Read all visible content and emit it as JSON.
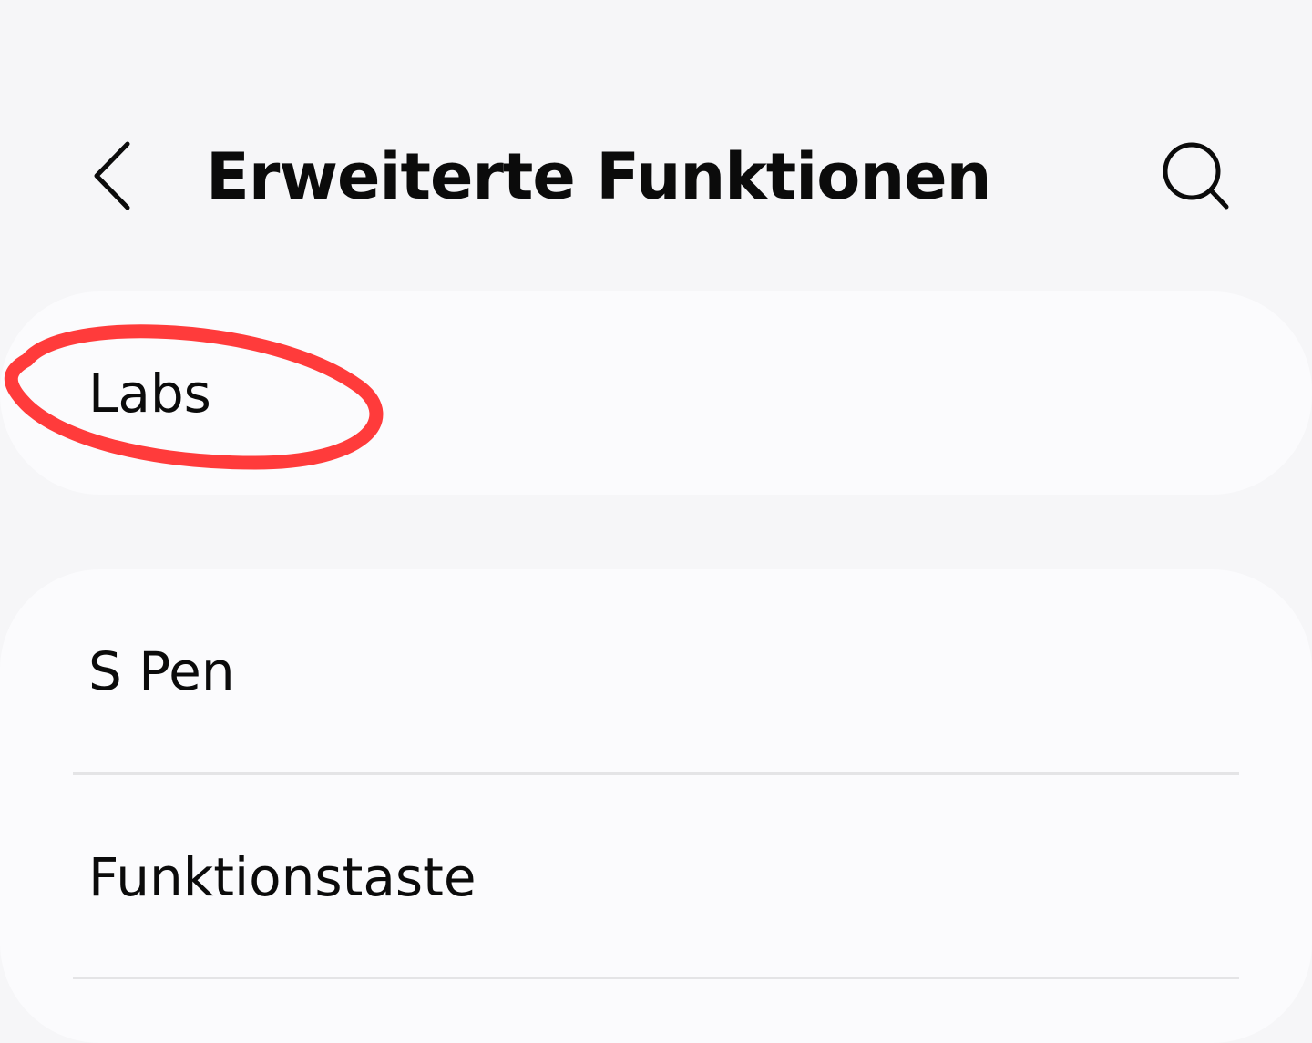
{
  "header": {
    "title": "Erweiterte Funktionen",
    "back_icon": "chevron-left-icon",
    "search_icon": "search-icon"
  },
  "labs_card": {
    "label": "Labs"
  },
  "settings_list": {
    "items": [
      {
        "label": "S Pen"
      },
      {
        "label": "Funktionstaste"
      }
    ]
  },
  "annotation": {
    "shape": "ellipse",
    "color": "#ff3b3b",
    "target": "Labs"
  },
  "colors": {
    "background": "#f6f6f8",
    "card": "#fbfbfd",
    "text": "#0b0b0b",
    "divider": "#e4e4e6"
  }
}
